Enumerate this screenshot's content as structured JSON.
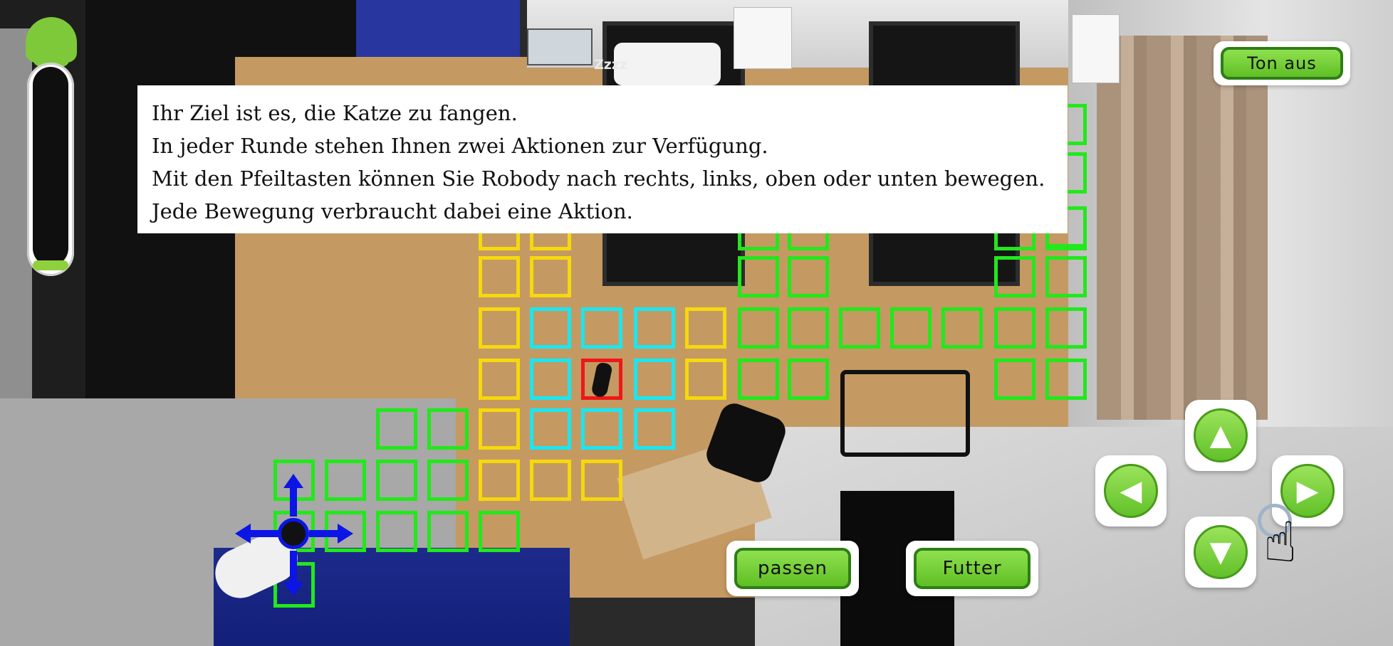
{
  "hud": {
    "sound_button_label": "Ton aus",
    "energy_level": 0.04
  },
  "scene": {
    "sleep_label": "Zzzz"
  },
  "tutorial": {
    "lines": [
      "Ihr Ziel ist es, die Katze zu fangen.",
      "In jeder Runde stehen Ihnen zwei Aktionen zur Verfügung.",
      "Mit den Pfeiltasten können Sie Robody nach rechts, links, oben oder unten bewegen.",
      "Jede Bewegung verbraucht dabei eine Aktion."
    ]
  },
  "actions": {
    "pass_label": "passen",
    "food_label": "Futter"
  },
  "dpad": {
    "up_icon": "arrow-up-icon",
    "down_icon": "arrow-down-icon",
    "left_icon": "arrow-left-icon",
    "right_icon": "arrow-right-icon",
    "hint_icon": "tap-hand-icon"
  },
  "colors": {
    "reachable_one_move": "#19e6f2",
    "reachable_two_moves": "#f6d80d",
    "open_tile": "#22e81c",
    "cat_tile": "#ef1717",
    "button_green": "#6fcb32"
  }
}
